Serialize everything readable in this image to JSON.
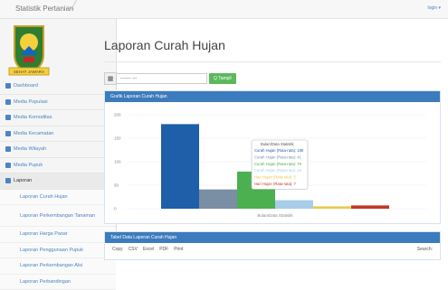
{
  "app": {
    "title": "Statistik Pertanian",
    "user_menu": "login ▾"
  },
  "logo": {
    "banner_text": "SEHAT JAWARA"
  },
  "sidebar": {
    "items": [
      {
        "label": "Dashboard",
        "icon": "dashboard-icon"
      },
      {
        "label": "Media Populasi",
        "icon": "user-icon"
      },
      {
        "label": "Media Komoditas",
        "icon": "leaf-icon"
      },
      {
        "label": "Media Kecamatan",
        "icon": "grid-icon"
      },
      {
        "label": "Media Wilayah",
        "icon": "wrench-icon"
      },
      {
        "label": "Media Pupuk",
        "icon": "tag-icon"
      },
      {
        "label": "Laporan",
        "icon": "file-icon"
      }
    ],
    "subitems": [
      "Laporan Curah Hujan",
      "Laporan Perkembangan Tanaman",
      "Laporan Harga Pasar",
      "Laporan Penggunaan Pupuk",
      "Laporan Perkembangan Alsi",
      "Laporan Perbandingan"
    ]
  },
  "page": {
    "title": "Laporan Curah Hujan"
  },
  "filter": {
    "select_value": "------- ---",
    "button_label": "Q Tampil"
  },
  "chart_panel": {
    "title": "Grafik Laporan Curah Hujan"
  },
  "chart_data": {
    "type": "bar",
    "xlabel": "Bulan/Data Statistik",
    "ylim": [
      0,
      200
    ],
    "yticks": [
      0,
      50,
      100,
      150,
      200
    ],
    "series": [
      {
        "value": 180,
        "color": "#1f5ea8"
      },
      {
        "value": 41,
        "color": "#7a8fa3"
      },
      {
        "value": 79,
        "color": "#4caf50"
      },
      {
        "value": 18,
        "color": "#a7cde8"
      },
      {
        "value": 5,
        "color": "#e8c94a"
      },
      {
        "value": 7,
        "color": "#c0392b"
      }
    ],
    "tooltip": {
      "title": "Bulan/Data Statistik",
      "lines": [
        "Curah Hujan (Rata-rata): 180",
        "Curah Hujan (Rata-rata): 41",
        "Curah Hujan (Rata-rata): 79",
        "Curah Hujan (Rata-rata): 18",
        "Hari Hujan (Rata-rata): 5",
        "Hari Hujan (Rata-rata): 7"
      ]
    }
  },
  "table_panel": {
    "title": "Tabel Data Laporan Curah Hujan",
    "controls": [
      "Copy",
      "CSV",
      "Excel",
      "PDF",
      "Print"
    ],
    "search_label": "Search:"
  }
}
